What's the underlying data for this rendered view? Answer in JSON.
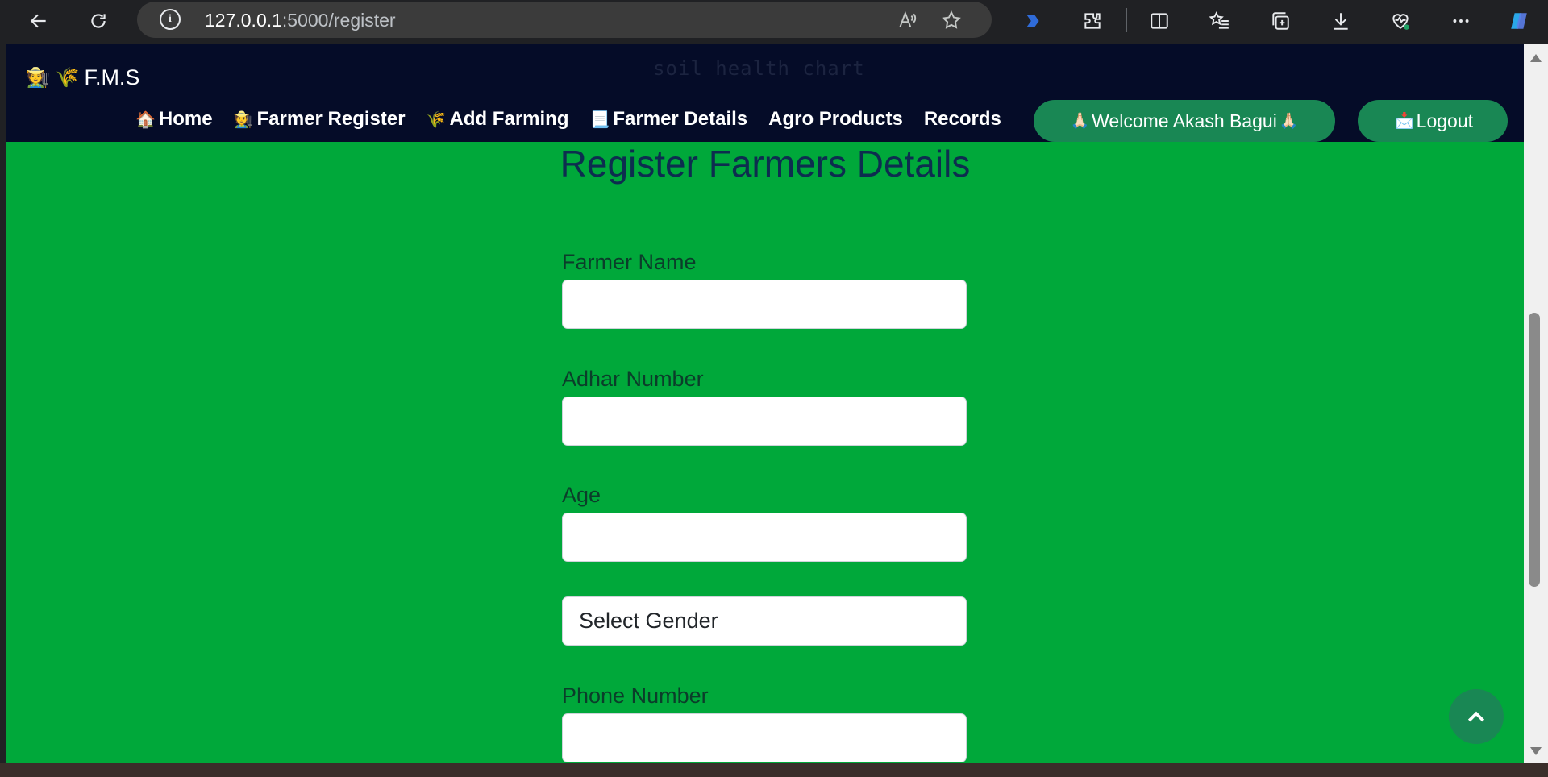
{
  "browser": {
    "url_host": "127.0.0.1",
    "url_path": ":5000/register",
    "info_glyph": "i"
  },
  "site": {
    "watermark": "soil health chart",
    "brand": {
      "icons": "🧑‍🌾 🌾",
      "text": "F.M.S"
    },
    "nav": [
      {
        "icon": "🏠",
        "label": "Home"
      },
      {
        "icon": "🧑‍🌾",
        "label": "Farmer Register"
      },
      {
        "icon": "🌾",
        "label": "Add Farming"
      },
      {
        "icon": "📃",
        "label": "Farmer Details"
      },
      {
        "icon": "",
        "label": "Agro Products"
      },
      {
        "icon": "",
        "label": "Records"
      }
    ],
    "welcome": {
      "icon": "🙏🏻",
      "text": "Welcome Akash Bagui"
    },
    "logout": {
      "icon": "📩",
      "text": "Logout"
    }
  },
  "form": {
    "title": "Register Farmers Details",
    "farmer_name_label": "Farmer Name",
    "adhar_label": "Adhar Number",
    "age_label": "Age",
    "gender_select": "Select Gender",
    "phone_label": "Phone Number"
  },
  "colors": {
    "page_bg": "#00a83a",
    "navbar_bg": "#050c28",
    "accent": "#198754",
    "title": "#0d2d4f"
  }
}
